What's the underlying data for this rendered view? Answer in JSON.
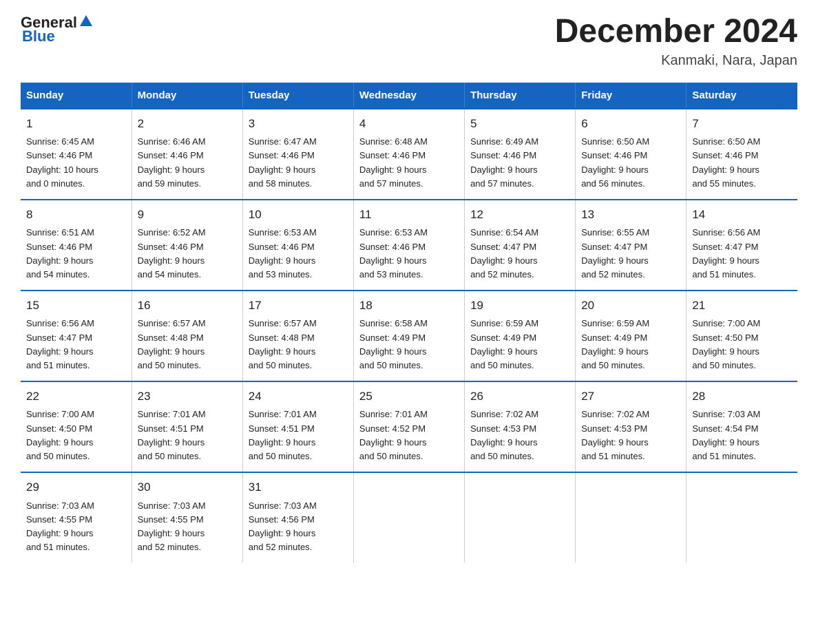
{
  "header": {
    "logo_general": "General",
    "logo_blue": "Blue",
    "title": "December 2024",
    "subtitle": "Kanmaki, Nara, Japan"
  },
  "columns": [
    "Sunday",
    "Monday",
    "Tuesday",
    "Wednesday",
    "Thursday",
    "Friday",
    "Saturday"
  ],
  "weeks": [
    [
      {
        "day": "1",
        "sunrise": "6:45 AM",
        "sunset": "4:46 PM",
        "daylight": "10 hours and 0 minutes."
      },
      {
        "day": "2",
        "sunrise": "6:46 AM",
        "sunset": "4:46 PM",
        "daylight": "9 hours and 59 minutes."
      },
      {
        "day": "3",
        "sunrise": "6:47 AM",
        "sunset": "4:46 PM",
        "daylight": "9 hours and 58 minutes."
      },
      {
        "day": "4",
        "sunrise": "6:48 AM",
        "sunset": "4:46 PM",
        "daylight": "9 hours and 57 minutes."
      },
      {
        "day": "5",
        "sunrise": "6:49 AM",
        "sunset": "4:46 PM",
        "daylight": "9 hours and 57 minutes."
      },
      {
        "day": "6",
        "sunrise": "6:50 AM",
        "sunset": "4:46 PM",
        "daylight": "9 hours and 56 minutes."
      },
      {
        "day": "7",
        "sunrise": "6:50 AM",
        "sunset": "4:46 PM",
        "daylight": "9 hours and 55 minutes."
      }
    ],
    [
      {
        "day": "8",
        "sunrise": "6:51 AM",
        "sunset": "4:46 PM",
        "daylight": "9 hours and 54 minutes."
      },
      {
        "day": "9",
        "sunrise": "6:52 AM",
        "sunset": "4:46 PM",
        "daylight": "9 hours and 54 minutes."
      },
      {
        "day": "10",
        "sunrise": "6:53 AM",
        "sunset": "4:46 PM",
        "daylight": "9 hours and 53 minutes."
      },
      {
        "day": "11",
        "sunrise": "6:53 AM",
        "sunset": "4:46 PM",
        "daylight": "9 hours and 53 minutes."
      },
      {
        "day": "12",
        "sunrise": "6:54 AM",
        "sunset": "4:47 PM",
        "daylight": "9 hours and 52 minutes."
      },
      {
        "day": "13",
        "sunrise": "6:55 AM",
        "sunset": "4:47 PM",
        "daylight": "9 hours and 52 minutes."
      },
      {
        "day": "14",
        "sunrise": "6:56 AM",
        "sunset": "4:47 PM",
        "daylight": "9 hours and 51 minutes."
      }
    ],
    [
      {
        "day": "15",
        "sunrise": "6:56 AM",
        "sunset": "4:47 PM",
        "daylight": "9 hours and 51 minutes."
      },
      {
        "day": "16",
        "sunrise": "6:57 AM",
        "sunset": "4:48 PM",
        "daylight": "9 hours and 50 minutes."
      },
      {
        "day": "17",
        "sunrise": "6:57 AM",
        "sunset": "4:48 PM",
        "daylight": "9 hours and 50 minutes."
      },
      {
        "day": "18",
        "sunrise": "6:58 AM",
        "sunset": "4:49 PM",
        "daylight": "9 hours and 50 minutes."
      },
      {
        "day": "19",
        "sunrise": "6:59 AM",
        "sunset": "4:49 PM",
        "daylight": "9 hours and 50 minutes."
      },
      {
        "day": "20",
        "sunrise": "6:59 AM",
        "sunset": "4:49 PM",
        "daylight": "9 hours and 50 minutes."
      },
      {
        "day": "21",
        "sunrise": "7:00 AM",
        "sunset": "4:50 PM",
        "daylight": "9 hours and 50 minutes."
      }
    ],
    [
      {
        "day": "22",
        "sunrise": "7:00 AM",
        "sunset": "4:50 PM",
        "daylight": "9 hours and 50 minutes."
      },
      {
        "day": "23",
        "sunrise": "7:01 AM",
        "sunset": "4:51 PM",
        "daylight": "9 hours and 50 minutes."
      },
      {
        "day": "24",
        "sunrise": "7:01 AM",
        "sunset": "4:51 PM",
        "daylight": "9 hours and 50 minutes."
      },
      {
        "day": "25",
        "sunrise": "7:01 AM",
        "sunset": "4:52 PM",
        "daylight": "9 hours and 50 minutes."
      },
      {
        "day": "26",
        "sunrise": "7:02 AM",
        "sunset": "4:53 PM",
        "daylight": "9 hours and 50 minutes."
      },
      {
        "day": "27",
        "sunrise": "7:02 AM",
        "sunset": "4:53 PM",
        "daylight": "9 hours and 51 minutes."
      },
      {
        "day": "28",
        "sunrise": "7:03 AM",
        "sunset": "4:54 PM",
        "daylight": "9 hours and 51 minutes."
      }
    ],
    [
      {
        "day": "29",
        "sunrise": "7:03 AM",
        "sunset": "4:55 PM",
        "daylight": "9 hours and 51 minutes."
      },
      {
        "day": "30",
        "sunrise": "7:03 AM",
        "sunset": "4:55 PM",
        "daylight": "9 hours and 52 minutes."
      },
      {
        "day": "31",
        "sunrise": "7:03 AM",
        "sunset": "4:56 PM",
        "daylight": "9 hours and 52 minutes."
      },
      {
        "day": "",
        "sunrise": "",
        "sunset": "",
        "daylight": ""
      },
      {
        "day": "",
        "sunrise": "",
        "sunset": "",
        "daylight": ""
      },
      {
        "day": "",
        "sunrise": "",
        "sunset": "",
        "daylight": ""
      },
      {
        "day": "",
        "sunrise": "",
        "sunset": "",
        "daylight": ""
      }
    ]
  ],
  "labels": {
    "sunrise": "Sunrise:",
    "sunset": "Sunset:",
    "daylight": "Daylight:"
  }
}
